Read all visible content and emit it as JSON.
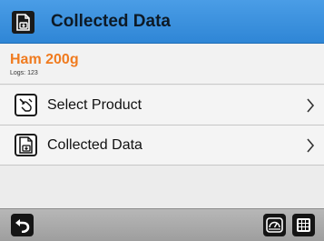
{
  "header": {
    "title": "Collected Data",
    "icon": "collected-data-icon",
    "background_color": "#3a91de"
  },
  "info": {
    "product_name": "Ham 200g",
    "logs": "Logs: 123",
    "product_color": "#f07b1f"
  },
  "menu": {
    "items": [
      {
        "label": "Select Product",
        "icon": "select-product-icon"
      },
      {
        "label": "Collected Data",
        "icon": "collected-data-icon"
      }
    ]
  },
  "footer": {
    "buttons": [
      {
        "icon": "back-icon"
      },
      {
        "icon": "scale-icon"
      },
      {
        "icon": "grid-menu-icon"
      }
    ]
  }
}
